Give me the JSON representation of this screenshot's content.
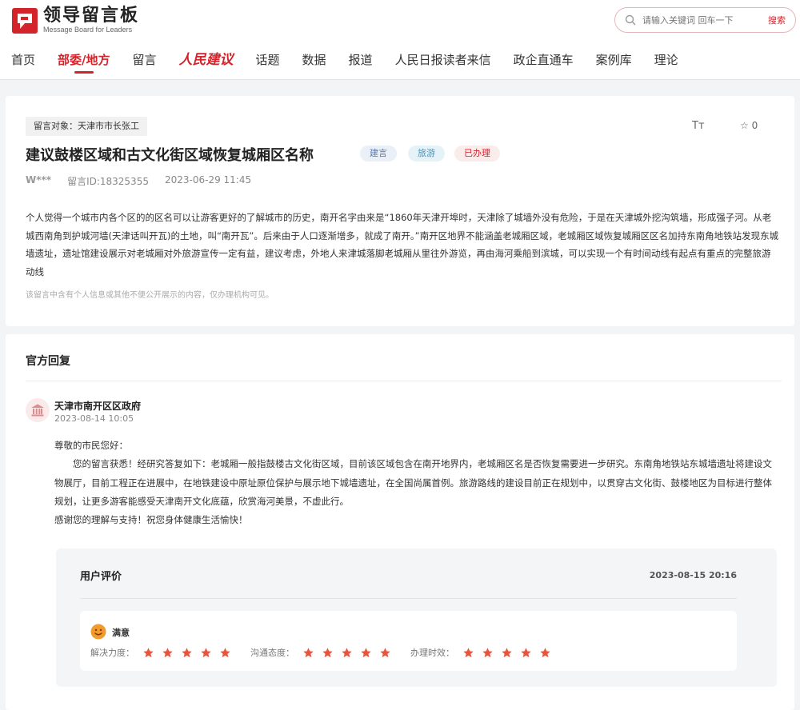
{
  "header": {
    "logo_title": "领导留言板",
    "logo_subtitle": "Message Board for Leaders",
    "brand_color": "#d3242c",
    "search": {
      "placeholder": "请输入关键词 回车一下",
      "button": "搜索"
    }
  },
  "nav": {
    "items": [
      {
        "label": "首页",
        "active": false
      },
      {
        "label": "部委/地方",
        "active": true
      },
      {
        "label": "留言",
        "active": false
      },
      {
        "label": "人民建议",
        "active": false,
        "style": "brand-logo"
      },
      {
        "label": "话题",
        "active": false
      },
      {
        "label": "数据",
        "active": false
      },
      {
        "label": "报道",
        "active": false
      },
      {
        "label": "人民日报读者来信",
        "active": false
      },
      {
        "label": "政企直通车",
        "active": false
      },
      {
        "label": "案例库",
        "active": false
      },
      {
        "label": "理论",
        "active": false
      }
    ]
  },
  "message": {
    "target": "留言对象：天津市市长张工",
    "font_tool": "Tт",
    "star_count": "☆ 0",
    "title": "建议鼓楼区域和古文化街区域恢复城厢区名称",
    "tags": [
      "建言",
      "旅游",
      "已办理"
    ],
    "user": "W***",
    "id": "留言ID:18325355",
    "time": "2023-06-29 11:45",
    "content": "个人觉得一个城市内各个区的的区名可以让游客更好的了解城市的历史，南开名字由来是“1860年天津开埠时，天津除了城墙外没有危险，于是在天津城外挖沟筑墙，形成强子河。从老城西南角到护城河墙(天津话叫开瓦)的土地，叫“南开瓦”。后来由于人口逐渐增多，就成了南开。”南开区地界不能涵盖老城厢区域，老城厢区域恢复城厢区区名加持东南角地铁站发现东城墙遗址，遗址馆建设展示对老城厢对外旅游宣传一定有益，建议考虑，外地人来津城落脚老城厢从里往外游览，再由海河乘船到滨城，可以实现一个有时间动线有起点有重点的完整旅游动线",
    "note": "该留言中含有个人信息或其他不便公开展示的内容，仅办理机构可见。"
  },
  "reply": {
    "section_title": "官方回复",
    "org": "天津市南开区区政府",
    "date": "2023-08-14 10:05",
    "greeting": "尊敬的市民您好：",
    "body": "您的留言获悉！经研究答复如下：老城厢一般指鼓楼古文化街区域，目前该区域包含在南开地界内，老城厢区名是否恢复需要进一步研究。东南角地铁站东城墙遗址将建设文物展厅，目前工程正在进展中，在地铁建设中原址原位保护与展示地下城墙遗址，在全国尚属首例。旅游路线的建设目前正在规划中，以贯穿古文化街、鼓楼地区为目标进行整体规划，让更多游客能感受天津南开文化底蕴，欣赏海河美景，不虚此行。",
    "closing": "感谢您的理解与支持！祝您身体健康生活愉快！"
  },
  "evaluation": {
    "title": "用户评价",
    "date": "2023-08-15 20:16",
    "result": "满意",
    "ratings": [
      {
        "label": "解决力度：",
        "stars": 5
      },
      {
        "label": "沟通态度：",
        "stars": 5
      },
      {
        "label": "办理时效：",
        "stars": 5
      }
    ]
  }
}
